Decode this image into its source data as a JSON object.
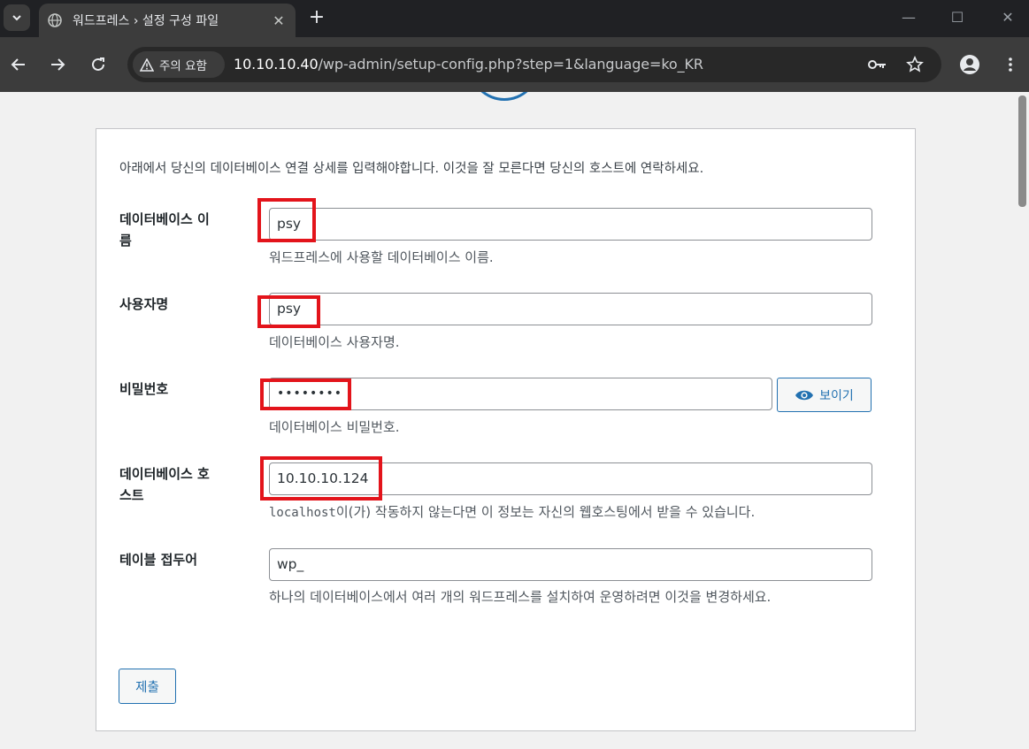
{
  "browser": {
    "tab_title": "워드프레스 › 설정 구성 파일",
    "security_label": "주의 요함",
    "url_host": "10.10.10.40",
    "url_path": "/wp-admin/setup-config.php?step=1&language=ko_KR"
  },
  "form": {
    "intro": "아래에서 당신의 데이터베이스 연결 상세를 입력해야합니다. 이것을 잘 모른다면 당신의 호스트에 연락하세요.",
    "dbname": {
      "label_line1": "데이터베이스 이",
      "label_line2": "름",
      "value": "psy",
      "description": "워드프레스에 사용할 데이터베이스 이름."
    },
    "username": {
      "label": "사용자명",
      "value": "psy",
      "description": "데이터베이스 사용자명."
    },
    "password": {
      "label": "비밀번호",
      "value": "••••••••",
      "show_label": "보이기",
      "description": "데이터베이스 비밀번호."
    },
    "dbhost": {
      "label_line1": "데이터베이스 호",
      "label_line2": "스트",
      "value": "10.10.10.124",
      "description_code": "localhost",
      "description_rest": "이(가) 작동하지 않는다면 이 정보는 자신의 웹호스팅에서 받을 수 있습니다."
    },
    "prefix": {
      "label": "테이블 접두어",
      "value": "wp_",
      "description": "하나의 데이터베이스에서 여러 개의 워드프레스를 설치하여 운영하려면 이것을 변경하세요."
    },
    "submit_label": "제출"
  },
  "colors": {
    "accent": "#2271b1",
    "highlight": "#e3141b"
  }
}
